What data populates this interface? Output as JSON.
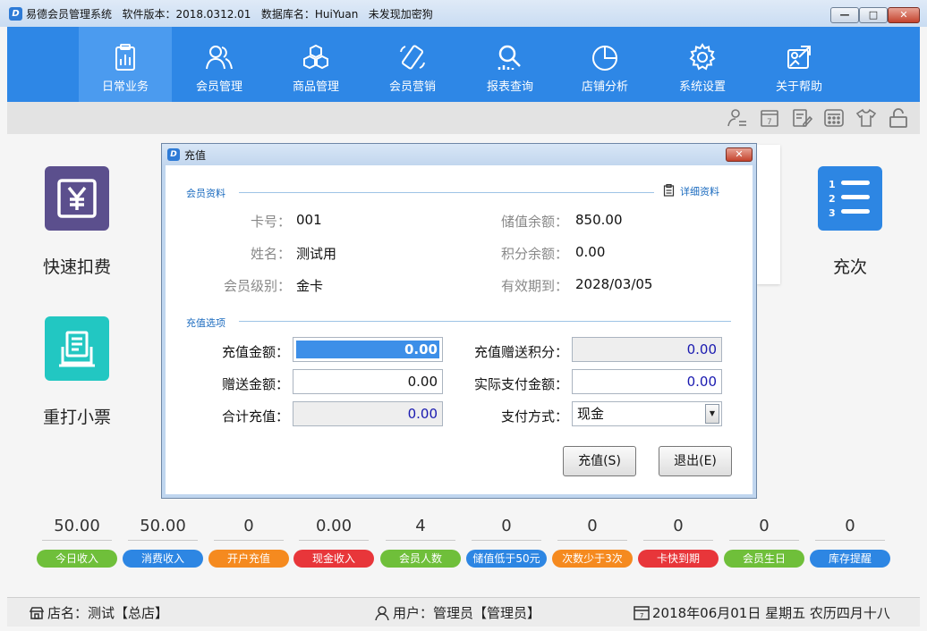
{
  "window": {
    "title": "易德会员管理系统   软件版本：2018.0312.01   数据库名：HuiYuan   未发现加密狗",
    "minimize": "—",
    "maximize": "□",
    "close": "✕"
  },
  "nav": [
    {
      "label": "日常业务",
      "icon": "clipboard-chart-icon",
      "active": true
    },
    {
      "label": "会员管理",
      "icon": "users-icon",
      "active": false
    },
    {
      "label": "商品管理",
      "icon": "cubes-icon",
      "active": false
    },
    {
      "label": "会员营销",
      "icon": "phone-icon",
      "active": false
    },
    {
      "label": "报表查询",
      "icon": "search-chart-icon",
      "active": false
    },
    {
      "label": "店铺分析",
      "icon": "pie-chart-icon",
      "active": false
    },
    {
      "label": "系统设置",
      "icon": "gear-icon",
      "active": false
    },
    {
      "label": "关于帮助",
      "icon": "help-icon",
      "active": false
    }
  ],
  "toolbar_icons": [
    "user-switch-icon",
    "calendar-icon",
    "edit-icon",
    "calculator-icon",
    "shirt-icon",
    "lock-icon"
  ],
  "tiles": {
    "quick_pay": "快速扣费",
    "reprint": "重打小票",
    "recharge_times": "充次"
  },
  "stats": [
    {
      "value": "50.00",
      "label": "今日收入",
      "color": "#6fbf3a"
    },
    {
      "value": "50.00",
      "label": "消费收入",
      "color": "#2d86e3"
    },
    {
      "value": "0",
      "label": "开户充值",
      "color": "#f58a1f"
    },
    {
      "value": "0.00",
      "label": "现金收入",
      "color": "#e8363a"
    },
    {
      "value": "4",
      "label": "会员人数",
      "color": "#6fbf3a"
    },
    {
      "value": "0",
      "label": "储值低于50元",
      "color": "#2d86e3"
    },
    {
      "value": "0",
      "label": "次数少于3次",
      "color": "#f58a1f"
    },
    {
      "value": "0",
      "label": "卡快到期",
      "color": "#e8363a"
    },
    {
      "value": "0",
      "label": "会员生日",
      "color": "#6fbf3a"
    },
    {
      "value": "0",
      "label": "库存提醒",
      "color": "#2d86e3"
    }
  ],
  "statusbar": {
    "store": "店名：测试【总店】",
    "user": "用户：管理员【管理员】",
    "date": "2018年06月01日 星期五 农历四月十八"
  },
  "dialog": {
    "title": "充值",
    "close": "✕",
    "member_section": "会员资料",
    "detail_link": "详细资料",
    "card_no_label": "卡号：",
    "card_no": "001",
    "name_label": "姓名：",
    "name": "测试用",
    "level_label": "会员级别：",
    "level": "金卡",
    "balance_label": "储值余额：",
    "balance": "850.00",
    "points_label": "积分余额：",
    "points": "0.00",
    "expiry_label": "有效期到：",
    "expiry": "2028/03/05",
    "options_section": "充值选项",
    "amount_label": "充值金额：",
    "amount": "0.00",
    "gift_amount_label": "赠送金额：",
    "gift_amount": "0.00",
    "total_label": "合计充值：",
    "total": "0.00",
    "gift_points_label": "充值赠送积分：",
    "gift_points": "0.00",
    "actual_pay_label": "实际支付金额：",
    "actual_pay": "0.00",
    "pay_method_label": "支付方式：",
    "pay_method": "现金",
    "recharge_button": "充值(S)",
    "exit_button": "退出(E)"
  }
}
